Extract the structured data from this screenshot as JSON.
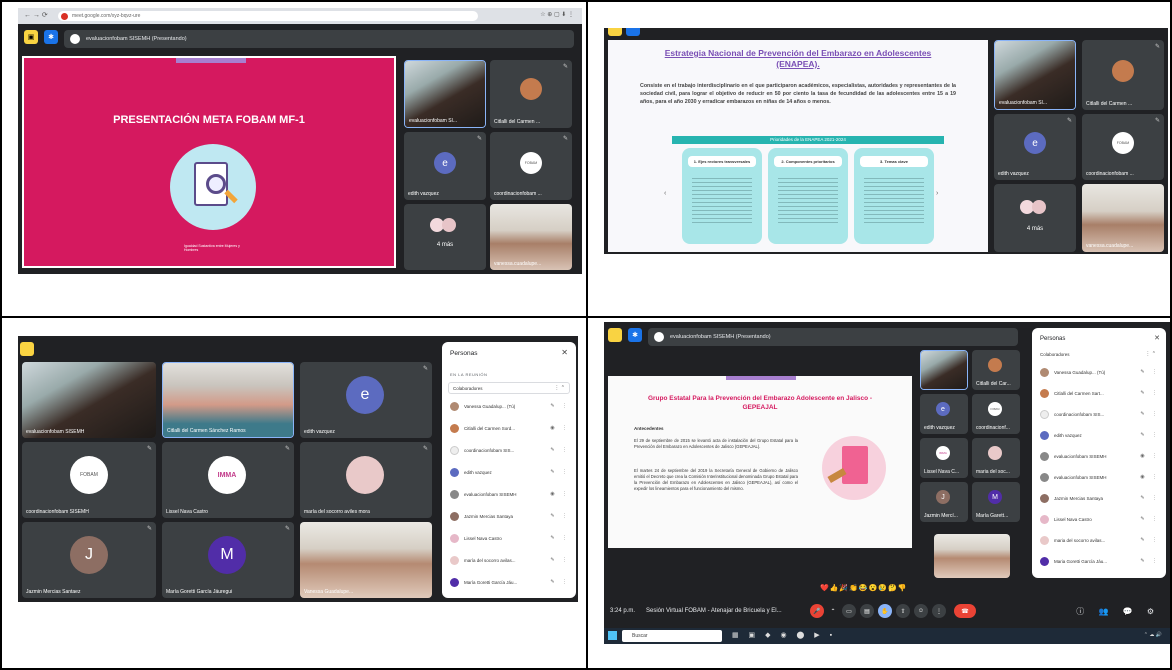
{
  "quad1": {
    "url": "meet.google.com/xyz-bqvz-ure",
    "meeting_title": "evaluacionfobam SISEMH (Presentando)",
    "slide_title": "PRESENTACIÓN META FOBAM MF-1",
    "slide_footer": "Igualdad Sustantiva entre Mujeres y Hombres",
    "tiles": [
      {
        "name": "evaluacionfobam SI..."
      },
      {
        "name": "Citlalli del Carmen ..."
      },
      {
        "name": "edith vazquez",
        "initial": "e"
      },
      {
        "name": "coordinacionfobam ...",
        "logo": "FOBAM"
      },
      {
        "name": "4 más"
      },
      {
        "name": "vanessa.cuadalupe..."
      }
    ]
  },
  "quad2": {
    "slide_title": "Estrategia Nacional de Prevención del Embarazo en Adolescentes (ENAPEA).",
    "slide_body": "Consiste en el trabajo interdisciplinario en el que participaron académicos, especialistas, autoridades y representantes de la sociedad civil, para lograr el objetivo de reducir en 50 por ciento la tasa de fecundidad de las adolescentes entre 15 a 19 años, para el año 2030 y erradicar embarazos en niñas de 14 años o menos.",
    "banner": "Prioridades de la ENAPEA 2021-2024",
    "cards": [
      "1. Ejes rectores transversales",
      "2. Componentes prioritarios",
      "3. Temas clave"
    ],
    "tiles": [
      {
        "name": "evaluacionfobam SI..."
      },
      {
        "name": "Citlalli del Carmen ..."
      },
      {
        "name": "edith vazquez",
        "initial": "e"
      },
      {
        "name": "coordinacionfobam ...",
        "logo": "FOBAM"
      },
      {
        "name": "4 más"
      },
      {
        "name": "vanessa.cuadalupe..."
      }
    ]
  },
  "quad3": {
    "tiles": [
      {
        "name": "evaluacionfobam SISEMH"
      },
      {
        "name": "Citlalli del Carmen Sánchez Ramos"
      },
      {
        "name": "edith vazquez",
        "initial": "e"
      },
      {
        "name": "coordinacionfobam SISEMH",
        "logo": "FOBAM"
      },
      {
        "name": "Lissel Nava Castro",
        "logo": "IMMA"
      },
      {
        "name": "maría del socorro aviles mora"
      },
      {
        "name": "Jazmin Mercias Santaez",
        "initial": "J"
      },
      {
        "name": "María Goretti García Jáuregui",
        "initial": "M"
      },
      {
        "name": "Vanessa Guadalupe..."
      }
    ],
    "panel": {
      "title": "Personas",
      "section": "EN LA REUNIÓN",
      "group": "Colaboradores",
      "people": [
        "Vanessa Guadalup... (Tú)",
        "Citlalli del Carmen Sord...",
        "coordinacionfobam SIS...",
        "edith vazquez",
        "evaluacionfobam SISEMH",
        "Jazmin Mercias Santaya",
        "Lissel Nava Castro",
        "maría del socorro avilas...",
        "María Goretti García Jáu..."
      ]
    }
  },
  "quad4": {
    "meeting_title": "evaluacionfobam SISEMH (Presentando)",
    "slide_title": "Grupo Estatal Para la Prevención del Embarazo Adolescente en Jalisco - GEPEAJAL",
    "slide_subtitle": "Antecedentes",
    "slide_p1": "El 29 de septiembre de 2015 se levantó acta de instalación del Grupo Estatal para la Prevención del Embarazo en Adolescentes de Jalisco (GEPEAJAL).",
    "slide_p2": "El martes 24 de septiembre del 2019 la Secretaría General de Gobierno de Jalisco emitió el Decreto que crea la Comisión Interinstitucional denominada Grupo Estatal para la Prevención del Embarazo en Adolescentes en Jalisco (GEPEAJAL), así como el expedir los lineamientos para el funcionamiento del mismo.",
    "time": "3:24 p.m.",
    "session": "Sesión Virtual FOBAM - Atenajar de Bricuela y El...",
    "search": "Buscar",
    "tiles": [
      {
        "name": "Citlalli del Car..."
      },
      {
        "name": "edith vazquez",
        "initial": "e"
      },
      {
        "name": "coordinacionf...",
        "logo": "FOBAM"
      },
      {
        "name": "Lissel Nava C...",
        "logo": "IMMA"
      },
      {
        "name": "maria del soc..."
      },
      {
        "name": "Jazmin Mercí...",
        "initial": "J"
      },
      {
        "name": "María Garett...",
        "initial": "M"
      }
    ],
    "panel": {
      "title": "Personas",
      "group": "Colaboradores",
      "people": [
        "Vanessa Guadalup... (Tú)",
        "Citlalli del Carmen Sart...",
        "coordinacionfobam SIS...",
        "edith vazquez",
        "evaluacionfobam SISEMH",
        "evaluacionfobam SISEMH",
        "Jazmin Mercias Santaya",
        "Lissel Nava Castro",
        "maria del socorro avilas...",
        "Maria Goretti García Jáu..."
      ]
    }
  }
}
